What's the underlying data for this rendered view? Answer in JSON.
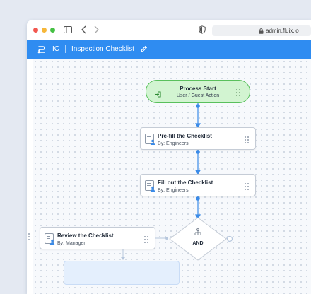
{
  "browser": {
    "url": "admin.fluix.io",
    "icons": [
      "sidebar-toggle-icon",
      "back-arrow-icon",
      "forward-arrow-icon",
      "shield-icon",
      "lock-icon"
    ]
  },
  "app": {
    "abbreviation": "IC",
    "title": "Inspection Checklist",
    "accent": "#2f8cf1"
  },
  "workflow": {
    "start": {
      "title": "Process Start",
      "subtitle": "User / Guest Action",
      "color": "#59c05c"
    },
    "steps": [
      {
        "title": "Pre-fill the Checklist",
        "assignee": "By: Engineers"
      },
      {
        "title": "Fill out the Checklist",
        "assignee": "By: Engineers"
      },
      {
        "title": "Review the Checklist",
        "assignee": "By: Manager"
      }
    ],
    "gateway": {
      "label": "AND"
    }
  }
}
